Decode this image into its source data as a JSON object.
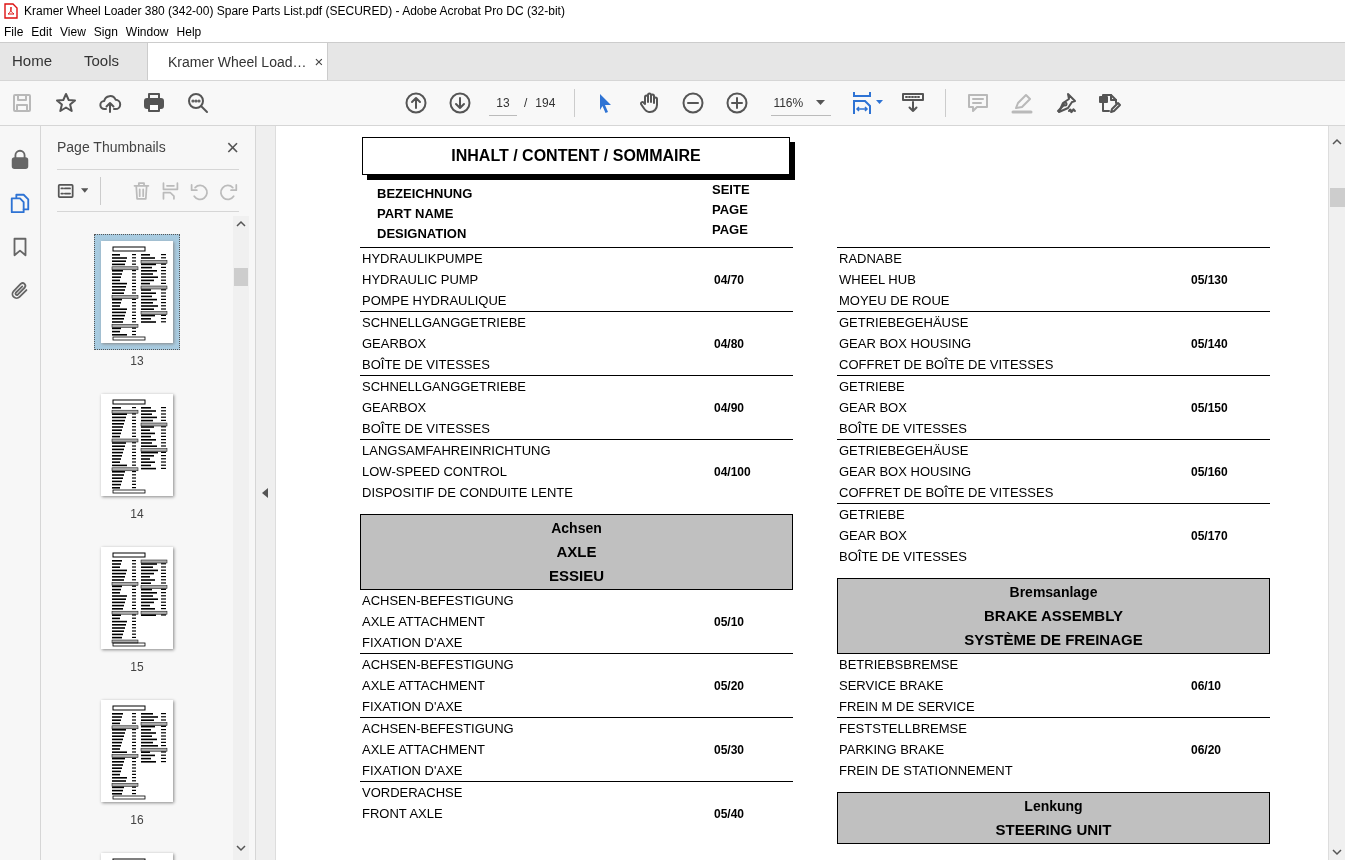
{
  "window": {
    "title": "Kramer Wheel Loader 380 (342-00) Spare Parts List.pdf (SECURED) - Adobe Acrobat Pro DC (32-bit)"
  },
  "menu": [
    "File",
    "Edit",
    "View",
    "Sign",
    "Window",
    "Help"
  ],
  "tabs": [
    {
      "label": "Home",
      "selected": false
    },
    {
      "label": "Tools",
      "selected": false
    },
    {
      "label": "Kramer Wheel Load…",
      "selected": true,
      "close": "×"
    }
  ],
  "toolbar": {
    "left": [
      {
        "kind": "save",
        "disabled": true
      },
      {
        "kind": "star",
        "disabled": false
      },
      {
        "kind": "upload",
        "disabled": false
      },
      {
        "kind": "print",
        "disabled": false
      },
      {
        "kind": "find",
        "disabled": false
      }
    ],
    "page_input": "13",
    "separator": "/",
    "page_total": "194",
    "zoom": "116%",
    "right": [
      {
        "kind": "comment",
        "disabled": true
      },
      {
        "kind": "highlight",
        "disabled": true
      },
      {
        "kind": "sign",
        "disabled": false
      },
      {
        "kind": "edit",
        "disabled": false
      }
    ]
  },
  "rail": [
    {
      "kind": "lock",
      "selected": false
    },
    {
      "kind": "pages",
      "selected": true
    },
    {
      "kind": "bookmark",
      "selected": false
    },
    {
      "kind": "attachment",
      "selected": false
    }
  ],
  "panel": {
    "title": "Page Thumbnails",
    "close": "×",
    "tools": [
      {
        "kind": "options",
        "disabled": false
      },
      {
        "kind": "delete",
        "disabled": true
      },
      {
        "kind": "insert",
        "disabled": true
      },
      {
        "kind": "rotate-left",
        "disabled": true
      },
      {
        "kind": "rotate-right",
        "disabled": true
      }
    ],
    "thumbnails": [
      {
        "label": "13",
        "selected": true
      },
      {
        "label": "14",
        "selected": false
      },
      {
        "label": "15",
        "selected": false
      },
      {
        "label": "16",
        "selected": false
      },
      {
        "selected": false
      }
    ]
  },
  "document": {
    "title": "INHALT / CONTENT / SOMMAIRE",
    "name_heading": [
      "BEZEICHNUNG",
      "PART NAME",
      "DESIGNATION"
    ],
    "page_heading": [
      "SEITE",
      "PAGE",
      "PAGE"
    ],
    "columns": [
      [
        {
          "kind": "entry",
          "lines": [
            "HYDRAULIKPUMPE",
            "HYDRAULIC PUMP",
            "POMPE HYDRAULIQUE"
          ],
          "page": "04/70"
        },
        {
          "kind": "entry",
          "lines": [
            "SCHNELLGANGGETRIEBE",
            "GEARBOX",
            "BOÎTE DE VITESSES"
          ],
          "page": "04/80"
        },
        {
          "kind": "entry",
          "lines": [
            "SCHNELLGANGGETRIEBE",
            "GEARBOX",
            "BOÎTE DE VITESSES"
          ],
          "page": "04/90"
        },
        {
          "kind": "entry",
          "lines": [
            "LANGSAMFAHREINRICHTUNG",
            "LOW-SPEED CONTROL",
            "DISPOSITIF DE CONDUITE LENTE"
          ],
          "page": "04/100"
        },
        {
          "kind": "section",
          "lines": [
            "Achsen",
            "AXLE",
            "ESSIEU"
          ]
        },
        {
          "kind": "entry",
          "lines": [
            "ACHSEN-BEFESTIGUNG",
            "AXLE ATTACHMENT",
            "FIXATION D'AXE"
          ],
          "page": "05/10"
        },
        {
          "kind": "entry",
          "lines": [
            "ACHSEN-BEFESTIGUNG",
            "AXLE ATTACHMENT",
            "FIXATION D'AXE"
          ],
          "page": "05/20"
        },
        {
          "kind": "entry",
          "lines": [
            "ACHSEN-BEFESTIGUNG",
            "AXLE ATTACHMENT",
            "FIXATION D'AXE"
          ],
          "page": "05/30"
        },
        {
          "kind": "entry",
          "lines": [
            "VORDERACHSE",
            "FRONT AXLE"
          ],
          "page": "05/40"
        }
      ],
      [
        {
          "kind": "entry",
          "lines": [
            "RADNABE",
            "WHEEL HUB",
            "MOYEU DE ROUE"
          ],
          "page": "05/130"
        },
        {
          "kind": "entry",
          "lines": [
            "GETRIEBEGEHÄUSE",
            "GEAR BOX HOUSING",
            "COFFRET DE BOÎTE DE VITESSES"
          ],
          "page": "05/140"
        },
        {
          "kind": "entry",
          "lines": [
            "GETRIEBE",
            "GEAR BOX",
            "BOÎTE DE VITESSES"
          ],
          "page": "05/150"
        },
        {
          "kind": "entry",
          "lines": [
            "GETRIEBEGEHÄUSE",
            "GEAR BOX HOUSING",
            "COFFRET DE BOÎTE DE VITESSES"
          ],
          "page": "05/160"
        },
        {
          "kind": "entry",
          "lines": [
            "GETRIEBE",
            "GEAR BOX",
            "BOÎTE DE VITESSES"
          ],
          "page": "05/170"
        },
        {
          "kind": "section",
          "lines": [
            "Bremsanlage",
            "BRAKE ASSEMBLY",
            "SYSTÈME DE FREINAGE"
          ]
        },
        {
          "kind": "entry",
          "lines": [
            "BETRIEBSBREMSE",
            "SERVICE BRAKE",
            "FREIN M DE SERVICE"
          ],
          "page": "06/10"
        },
        {
          "kind": "entry",
          "lines": [
            "FESTSTELLBREMSE",
            "PARKING BRAKE",
            "FREIN DE STATIONNEMENT"
          ],
          "page": "06/20"
        },
        {
          "kind": "section",
          "lines": [
            "Lenkung",
            "STEERING UNIT"
          ]
        }
      ]
    ]
  }
}
